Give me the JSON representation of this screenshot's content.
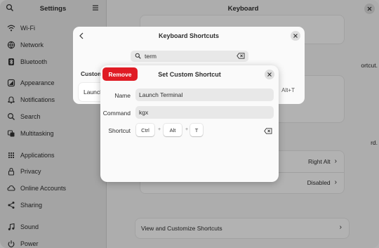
{
  "sidebar": {
    "title": "Settings",
    "items": [
      {
        "label": "Wi-Fi",
        "icon": "wifi-icon"
      },
      {
        "label": "Network",
        "icon": "network-icon"
      },
      {
        "label": "Bluetooth",
        "icon": "bluetooth-icon"
      },
      {
        "label": "Appearance",
        "icon": "appearance-icon"
      },
      {
        "label": "Notifications",
        "icon": "bell-icon"
      },
      {
        "label": "Search",
        "icon": "search-icon"
      },
      {
        "label": "Multitasking",
        "icon": "multitasking-icon"
      },
      {
        "label": "Applications",
        "icon": "applications-icon"
      },
      {
        "label": "Privacy",
        "icon": "lock-icon"
      },
      {
        "label": "Online Accounts",
        "icon": "cloud-icon"
      },
      {
        "label": "Sharing",
        "icon": "share-icon"
      },
      {
        "label": "Sound",
        "icon": "music-note-icon"
      },
      {
        "label": "Power",
        "icon": "power-icon"
      }
    ]
  },
  "content": {
    "title": "Keyboard",
    "partial_text_1": "ortcut.",
    "partial_text_2": "rd.",
    "right_alt_label": "Right Alt",
    "disabled_label": "Disabled",
    "view_shortcuts_label": "View and Customize Shortcuts",
    "chevron": "›"
  },
  "shortcuts_dialog": {
    "title": "Keyboard Shortcuts",
    "search_value": "term",
    "custom_heading": "Custom",
    "launch_label": "Launch",
    "alt_t": "Alt+T"
  },
  "custom_shortcut_dialog": {
    "title": "Set Custom Shortcut",
    "remove_label": "Remove",
    "name_label": "Name",
    "name_value": "Launch Terminal",
    "command_label": "Command",
    "command_value": "kgx",
    "shortcut_label": "Shortcut",
    "keys": [
      "Ctrl",
      "Alt",
      "T"
    ],
    "plus": "+"
  },
  "colors": {
    "destructive": "#e01b24"
  }
}
